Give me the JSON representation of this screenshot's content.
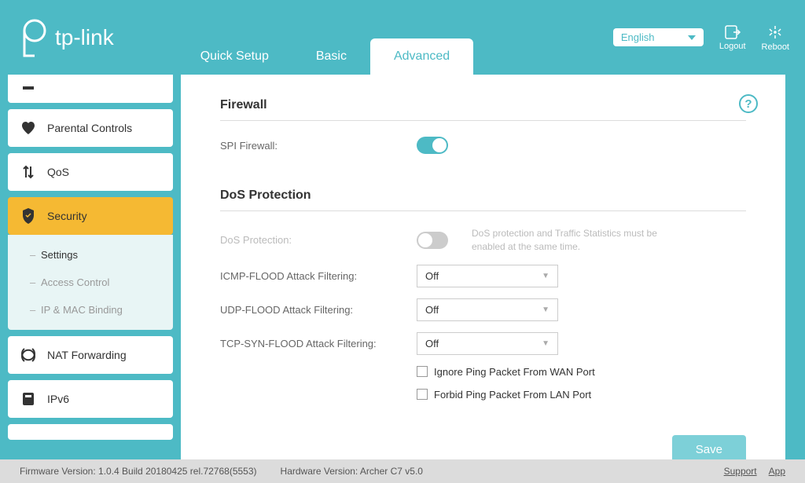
{
  "brand": "tp-link",
  "tabs": {
    "quick_setup": "Quick Setup",
    "basic": "Basic",
    "advanced": "Advanced"
  },
  "language": "English",
  "header_actions": {
    "logout": "Logout",
    "reboot": "Reboot"
  },
  "sidebar": {
    "parental_controls": "Parental Controls",
    "qos": "QoS",
    "security": "Security",
    "security_sub": {
      "settings": "Settings",
      "access_control": "Access Control",
      "ip_mac_binding": "IP & MAC Binding"
    },
    "nat_forwarding": "NAT Forwarding",
    "ipv6": "IPv6"
  },
  "content": {
    "firewall_title": "Firewall",
    "spi_firewall_label": "SPI Firewall:",
    "spi_firewall_on": true,
    "dos_title": "DoS Protection",
    "dos_protection_label": "DoS Protection:",
    "dos_protection_on": false,
    "dos_note": "DoS protection and Traffic Statistics must be enabled at the same time.",
    "icmp_label": "ICMP-FLOOD Attack Filtering:",
    "icmp_value": "Off",
    "udp_label": "UDP-FLOOD Attack Filtering:",
    "udp_value": "Off",
    "tcp_label": "TCP-SYN-FLOOD Attack Filtering:",
    "tcp_value": "Off",
    "ignore_ping_wan": "Ignore Ping Packet From WAN Port",
    "forbid_ping_lan": "Forbid Ping Packet From LAN Port",
    "save_btn": "Save"
  },
  "footer": {
    "firmware": "Firmware Version: 1.0.4 Build 20180425 rel.72768(5553)",
    "hardware": "Hardware Version: Archer C7 v5.0",
    "support": "Support",
    "app": "App"
  }
}
